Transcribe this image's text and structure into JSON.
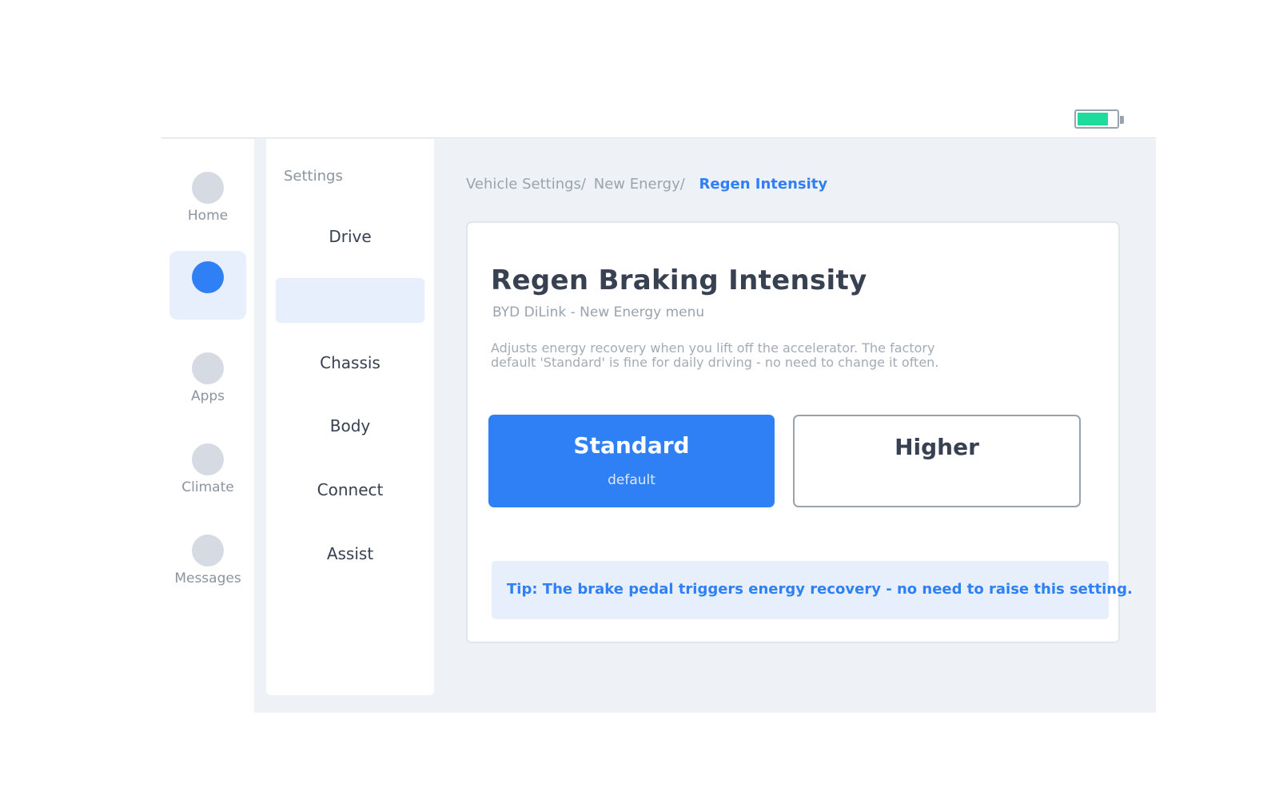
{
  "status": {
    "battery_level": 0.8,
    "battery_color": "#1edc9c"
  },
  "nav": {
    "items": [
      {
        "label": "Home",
        "active": false
      },
      {
        "label": "",
        "active": true
      },
      {
        "label": "Apps",
        "active": false
      },
      {
        "label": "Climate",
        "active": false
      },
      {
        "label": "Messages",
        "active": false
      }
    ]
  },
  "settings": {
    "heading": "Settings",
    "items": [
      {
        "label": "Drive"
      },
      {
        "label": ""
      },
      {
        "label": "Chassis"
      },
      {
        "label": "Body"
      },
      {
        "label": "Connect"
      },
      {
        "label": "Assist"
      }
    ]
  },
  "breadcrumb": {
    "items": [
      "Vehicle Settings",
      "New Energy"
    ],
    "separator": "/",
    "current": "Regen Intensity"
  },
  "card": {
    "title": "Regen Braking Intensity",
    "subtitle": "BYD DiLink - New Energy menu",
    "description": "Adjusts energy recovery when you lift off the accelerator. The factory default 'Standard' is fine for daily driving - no need to change it often.",
    "options": [
      {
        "label": "Standard",
        "sublabel": "default",
        "selected": true
      },
      {
        "label": "Higher",
        "sublabel": "",
        "selected": false
      }
    ],
    "tip": "Tip: The brake pedal triggers energy recovery - no need to raise this setting."
  },
  "colors": {
    "accent": "#2f80f4",
    "accent_light": "#e6effb",
    "background": "#eef2f7"
  }
}
